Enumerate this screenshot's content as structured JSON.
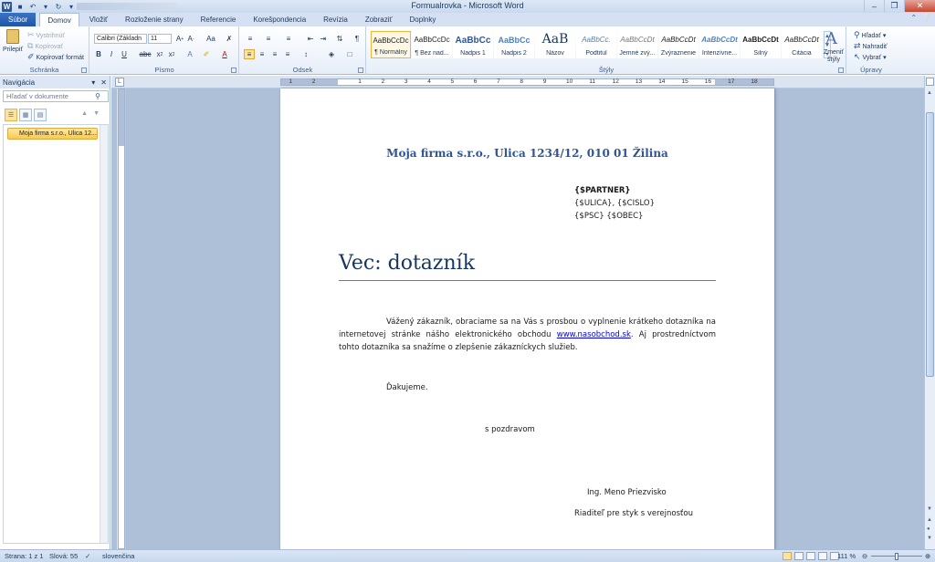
{
  "window": {
    "title": "Formualrovka - Microsoft Word"
  },
  "tabs": [
    "Súbor",
    "Domov",
    "Vložiť",
    "Rozloženie strany",
    "Referencie",
    "Korešpondencia",
    "Revízia",
    "Zobraziť",
    "Doplnky"
  ],
  "ribbon": {
    "clipboard": {
      "label": "Schránka",
      "paste": "Prilepiť",
      "cut": "Vystrihnúť",
      "copy": "Kopírovať",
      "format_painter": "Kopírovať formát"
    },
    "font": {
      "label": "Písmo",
      "font_name": "Calibri (Základn",
      "font_size": "11"
    },
    "paragraph": {
      "label": "Odsek"
    },
    "styles": {
      "label": "Štýly",
      "items": [
        {
          "sample": "AaBbCcDc",
          "name": "¶ Normálny"
        },
        {
          "sample": "AaBbCcDc",
          "name": "¶ Bez riad..."
        },
        {
          "sample": "AaBbCc",
          "name": "Nadpis 1"
        },
        {
          "sample": "AaBbCc",
          "name": "Nadpis 2"
        },
        {
          "sample": "AaB",
          "name": "Názov"
        },
        {
          "sample": "AaBbCc.",
          "name": "Podtitul"
        },
        {
          "sample": "AaBbCcDt",
          "name": "Jemné zvý..."
        },
        {
          "sample": "AaBbCcDt",
          "name": "Zvýraznenie"
        },
        {
          "sample": "AaBbCcDt",
          "name": "Intenzívne..."
        },
        {
          "sample": "AaBbCcDt",
          "name": "Silný"
        },
        {
          "sample": "AaBbCcDt",
          "name": "Citácia"
        }
      ],
      "change_styles": "Zmeniť štýly"
    },
    "editing": {
      "label": "Úpravy",
      "find": "Hľadať",
      "replace": "Nahradiť",
      "select": "Vybrať"
    }
  },
  "nav": {
    "title": "Navigácia",
    "search_placeholder": "Hľadať v dokumente",
    "heading": "Moja firma s.r.o., Ulica 12..."
  },
  "ruler": {
    "ticks": [
      "1",
      "2",
      "1",
      "2",
      "3",
      "4",
      "5",
      "6",
      "7",
      "8",
      "9",
      "10",
      "11",
      "12",
      "13",
      "14",
      "15",
      "16",
      "17",
      "18"
    ]
  },
  "document": {
    "company": "Moja firma s.r.o., Ulica 1234/12, 010 01 Žilina",
    "partner": "{$PARTNER}",
    "street": "{$ULICA}, {$CISLO}",
    "city": "{$PSC} {$OBEC}",
    "subject": "Vec: dotazník",
    "body_before_link": "Vážený zákazník, obraciame sa na Vás s prosbou o vyplnenie krátkeho dotazníka na internetovej stránke nášho elektronického obchodu ",
    "link": "www.nasobchod.sk",
    "body_after_link": ". Aj prostredníctvom tohto dotazníka sa snažíme o zlepšenie zákazníckych služieb.",
    "thanks": "Ďakujeme.",
    "regards": "s pozdravom",
    "signer_name": "Ing. Meno Priezvisko",
    "signer_role": "Riaditeľ pre styk s verejnosťou"
  },
  "status": {
    "page": "Strana: 1 z 1",
    "words": "Slová: 55",
    "language": "slovenčina",
    "zoom": "111 %"
  },
  "colors": {
    "heading_blue": "#2f5597",
    "title_blue": "#17365d",
    "rule_blue": "#4f81bd",
    "file_tab": "#1f56a8"
  }
}
